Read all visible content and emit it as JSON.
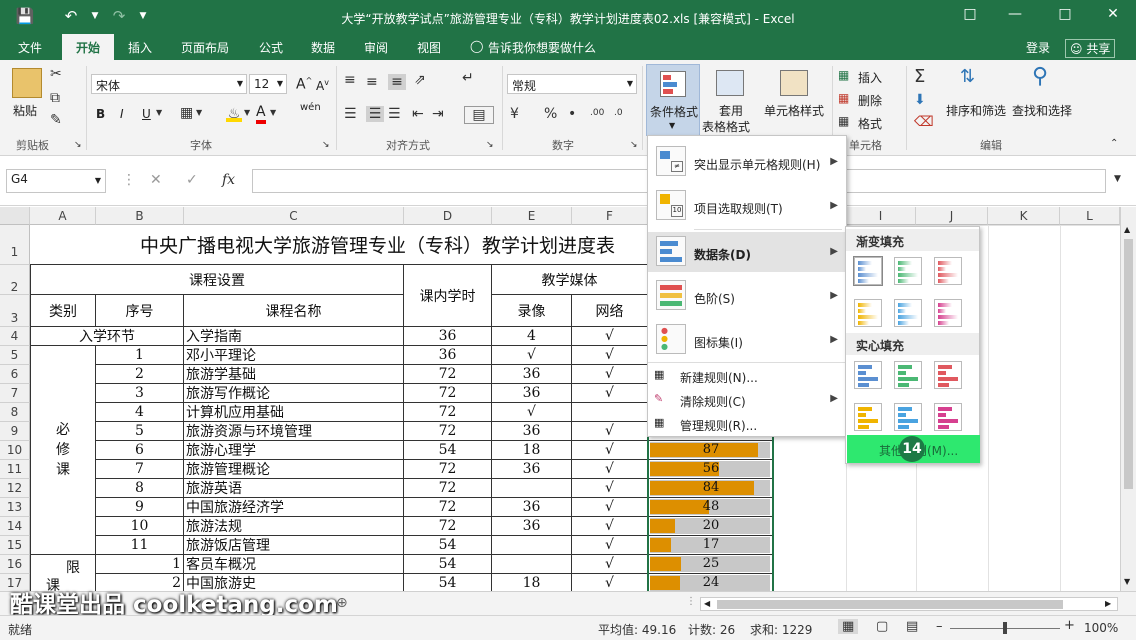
{
  "window": {
    "title": "大学“开放教学试点”旅游管理专业（专科）教学计划进度表02.xls  [兼容模式] - Excel"
  },
  "tabs": [
    "文件",
    "开始",
    "插入",
    "页面布局",
    "公式",
    "数据",
    "审阅",
    "视图"
  ],
  "tell_me": "告诉我你想要做什么",
  "login": "登录",
  "share": "共享",
  "ribbon": {
    "paste": "粘贴",
    "clipboard": "剪贴板",
    "font_name": "宋体",
    "font_size": "12",
    "font_group": "字体",
    "align_group": "对齐方式",
    "number_format": "常规",
    "number_group": "数字",
    "cond_format": "条件格式",
    "table_format_1": "套用",
    "table_format_2": "表格格式",
    "cell_style": "单元格样式",
    "insert": "插入",
    "delete": "删除",
    "format": "格式",
    "cells_group": "单元格",
    "sort_filter": "排序和筛选",
    "find_select": "查找和选择",
    "edit_group": "编辑",
    "bold": "B",
    "italic": "I",
    "underline": "U",
    "font_color_a": "A",
    "phonetic": "wén"
  },
  "formula": {
    "name_box": "G4",
    "fx": "fx"
  },
  "columns": [
    "A",
    "B",
    "C",
    "D",
    "E",
    "F",
    "G",
    "H",
    "I",
    "J",
    "K",
    "L"
  ],
  "rows": [
    "1",
    "2",
    "3",
    "4",
    "5",
    "6",
    "7",
    "8",
    "9",
    "10",
    "11",
    "12",
    "13",
    "14",
    "15",
    "16",
    "17"
  ],
  "sheet": {
    "title": "中央广播电视大学旅游管理专业（专科）教学计划进度表",
    "course_setup": "课程设置",
    "hours_header": "课内学时",
    "media_header": "教学媒体",
    "category": "类别",
    "seq": "序号",
    "course_name": "课程名称",
    "video": "录像",
    "network": "网络",
    "intro_section": "入学环节",
    "required_label_1": "必",
    "required_label_2": "修",
    "required_label_3": "课",
    "elective_label_1": "限",
    "elective_label_2": "课",
    "rows": [
      {
        "seq": "",
        "name": "入学指南",
        "hours": "36",
        "video": "4",
        "net": "√"
      },
      {
        "seq": "1",
        "name": "邓小平理论",
        "hours": "36",
        "video": "√",
        "net": "√"
      },
      {
        "seq": "2",
        "name": "旅游学基础",
        "hours": "72",
        "video": "36",
        "net": "√"
      },
      {
        "seq": "3",
        "name": "旅游写作概论",
        "hours": "72",
        "video": "36",
        "net": "√"
      },
      {
        "seq": "4",
        "name": "计算机应用基础",
        "hours": "72",
        "video": "√",
        "net": ""
      },
      {
        "seq": "5",
        "name": "旅游资源与环境管理",
        "hours": "72",
        "video": "36",
        "net": "√"
      },
      {
        "seq": "6",
        "name": "旅游心理学",
        "hours": "54",
        "video": "18",
        "net": "√"
      },
      {
        "seq": "7",
        "name": "旅游管理概论",
        "hours": "72",
        "video": "36",
        "net": "√"
      },
      {
        "seq": "8",
        "name": "旅游英语",
        "hours": "72",
        "video": "",
        "net": "√"
      },
      {
        "seq": "9",
        "name": "中国旅游经济学",
        "hours": "72",
        "video": "36",
        "net": "√"
      },
      {
        "seq": "10",
        "name": "旅游法规",
        "hours": "72",
        "video": "36",
        "net": "√"
      },
      {
        "seq": "11",
        "name": "旅游饭店管理",
        "hours": "54",
        "video": "",
        "net": "√"
      },
      {
        "seq": "1",
        "name": "客员车概况",
        "hours": "54",
        "video": "",
        "net": "√"
      },
      {
        "seq": "2",
        "name": "中国旅游史",
        "hours": "54",
        "video": "18",
        "net": "√"
      }
    ],
    "bars": [
      {
        "value": 87,
        "label": "87"
      },
      {
        "value": 56,
        "label": "56"
      },
      {
        "value": 84,
        "label": "84"
      },
      {
        "value": 48,
        "label": "48"
      },
      {
        "value": 20,
        "label": "20"
      },
      {
        "value": 17,
        "label": "17"
      },
      {
        "value": 25,
        "label": "25"
      },
      {
        "value": 24,
        "label": "24"
      }
    ]
  },
  "menu": {
    "highlight": "突出显示单元格规则(H)",
    "top_bottom": "项目选取规则(T)",
    "data_bars": "数据条(D)",
    "color_scales": "色阶(S)",
    "icon_sets": "图标集(I)",
    "new_rule": "新建规则(N)...",
    "clear_rules": "清除规则(C)",
    "manage_rules": "管理规则(R)..."
  },
  "submenu": {
    "gradient": "渐变填充",
    "solid": "实心填充",
    "more_rules": "其他规则(M)...",
    "step_badge": "14",
    "bar_colors": [
      "#5b8fd1",
      "#4bb874",
      "#e0595f",
      "#f0b400",
      "#4aa3e0",
      "#d6408f"
    ]
  },
  "status": {
    "ready": "就绪",
    "average": "平均值: 49.16",
    "count": "计数: 26",
    "sum": "求和: 1229",
    "zoom": "100%"
  },
  "watermark": "酷课堂出品 coolketang.com"
}
